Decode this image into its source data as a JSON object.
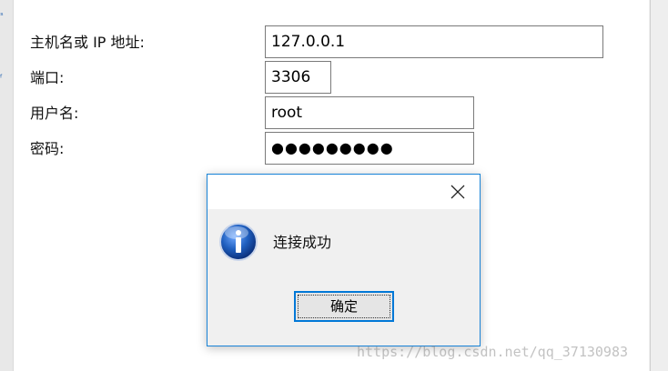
{
  "form": {
    "host_label": "主机名或 IP 地址:",
    "host_value": "127.0.0.1",
    "port_label": "端口:",
    "port_value": "3306",
    "user_label": "用户名:",
    "user_value": "root",
    "password_label": "密码:",
    "password_value": "●●●●●●●●●"
  },
  "dialog": {
    "message": "连接成功",
    "ok_label": "确定",
    "icon": "info-icon",
    "close_icon": "close-icon"
  },
  "watermark": "https://blog.csdn.net/qq_37130983",
  "colors": {
    "dialog_border": "#1883d7",
    "button_border": "#0078d7",
    "info_blue": "#1f5fbf"
  }
}
